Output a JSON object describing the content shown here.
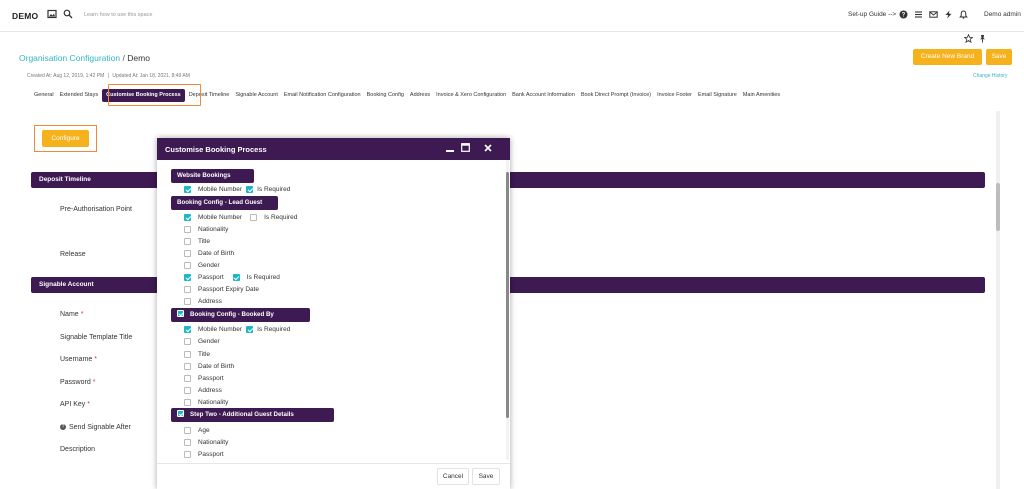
{
  "topbar": {
    "logo": "DEMO",
    "learn_placeholder": "Learn how to use this space",
    "setup_guide": "Set-up Guide -->",
    "user": "Demo admin"
  },
  "header": {
    "breadcrumb_link": "Organisation Configuration",
    "breadcrumb_sep": "/",
    "breadcrumb_current": "Demo",
    "created": "Created At: Aug 12, 2019, 1:42 PM",
    "meta_sep": "|",
    "updated": "Updated At: Jan 18, 2021, 8:49 AM",
    "create_brand_label": "Create New Brand",
    "save_label": "Save",
    "change_history": "Change History"
  },
  "tabs": [
    {
      "label": "General"
    },
    {
      "label": "Extended Stays"
    },
    {
      "label": "Customise Booking Process"
    },
    {
      "label": "Deposit Timeline"
    },
    {
      "label": "Signable Account"
    },
    {
      "label": "Email Notification Configuration"
    },
    {
      "label": "Booking Config"
    },
    {
      "label": "Address"
    },
    {
      "label": "Invoice & Xero Configuration"
    },
    {
      "label": "Bank Account Information"
    },
    {
      "label": "Book Direct Prompt (Invoice)"
    },
    {
      "label": "Invoice Footer"
    },
    {
      "label": "Email Signature"
    },
    {
      "label": "Main Amenities"
    }
  ],
  "active_tab": "Customise Booking Process",
  "configure_label": "Configure",
  "sections": {
    "deposit_timeline": {
      "title": "Deposit Timeline",
      "fields": [
        "Pre-Authorisation Point",
        "Release"
      ]
    },
    "signable_account": {
      "title": "Signable Account",
      "fields": [
        {
          "label": "Name",
          "required": "*"
        },
        {
          "label": "Signable Template Title",
          "required": ""
        },
        {
          "label": "Username",
          "required": "*"
        },
        {
          "label": "Password",
          "required": "*"
        },
        {
          "label": "API Key",
          "required": "*"
        },
        {
          "label": "Send Signable After",
          "required": "",
          "help": "?"
        },
        {
          "label": "Description",
          "required": ""
        }
      ]
    }
  },
  "modal": {
    "title": "Customise Booking Process",
    "groups": {
      "website_bookings": {
        "title": "Website Bookings",
        "mobile_label": "Mobile Number",
        "is_required_label": "Is Required"
      },
      "lead_guest": {
        "title": "Booking Config - Lead Guest",
        "items": [
          {
            "label": "Mobile Number",
            "checked": true,
            "req_label": "Is Required",
            "req_checked": false
          },
          {
            "label": "Nationality",
            "checked": false
          },
          {
            "label": "Title",
            "checked": false
          },
          {
            "label": "Date of Birth",
            "checked": false
          },
          {
            "label": "Gender",
            "checked": false
          },
          {
            "label": "Passport",
            "checked": true,
            "req_label": "Is Required",
            "req_checked": true
          },
          {
            "label": "Passport Expiry Date",
            "checked": false
          },
          {
            "label": "Address",
            "checked": false
          }
        ]
      },
      "booked_by": {
        "title": "Booking Config - Booked By",
        "checked": true,
        "items": [
          {
            "label": "Mobile Number",
            "checked": true,
            "req_label": "Is Required",
            "req_checked": true
          },
          {
            "label": "Gender",
            "checked": false
          },
          {
            "label": "Title",
            "checked": false
          },
          {
            "label": "Date of Birth",
            "checked": false
          },
          {
            "label": "Passport",
            "checked": false
          },
          {
            "label": "Address",
            "checked": false
          },
          {
            "label": "Nationality",
            "checked": false
          }
        ]
      },
      "additional_guests": {
        "title": "Step Two - Additional Guest Details",
        "checked": true,
        "items": [
          {
            "label": "Age",
            "checked": false
          },
          {
            "label": "Nationality",
            "checked": false
          },
          {
            "label": "Passport",
            "checked": false
          }
        ]
      }
    },
    "cancel_label": "Cancel",
    "save_label": "Save"
  },
  "colors": {
    "brand_purple": "#3d1a52",
    "accent_orange": "#f6b21c",
    "link_teal": "#33b5c8",
    "checkbox_teal": "#1fb6c4",
    "highlight_orange": "#f08a3a"
  }
}
